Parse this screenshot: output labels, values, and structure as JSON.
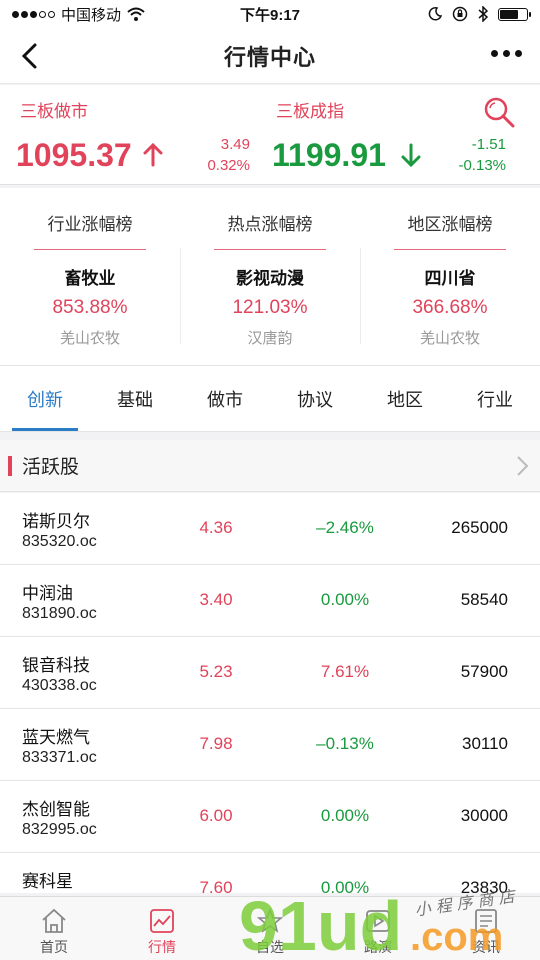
{
  "status_bar": {
    "carrier": "中国移动",
    "time": "下午9:17"
  },
  "nav": {
    "title": "行情中心"
  },
  "indices": [
    {
      "name": "三板做市",
      "value": "1095.37",
      "change": "3.49",
      "change_pct": "0.32%",
      "direction": "up"
    },
    {
      "name": "三板成指",
      "value": "1199.91",
      "change": "-1.51",
      "change_pct": "-0.13%",
      "direction": "down"
    }
  ],
  "rankings": [
    {
      "title": "行业涨幅榜",
      "sector": "畜牧业",
      "pct": "853.88%",
      "stock": "羌山农牧"
    },
    {
      "title": "热点涨幅榜",
      "sector": "影视动漫",
      "pct": "121.03%",
      "stock": "汉唐韵"
    },
    {
      "title": "地区涨幅榜",
      "sector": "四川省",
      "pct": "366.68%",
      "stock": "羌山农牧"
    }
  ],
  "tabs": [
    "创新",
    "基础",
    "做市",
    "协议",
    "地区",
    "行业"
  ],
  "section": {
    "title": "活跃股"
  },
  "stocks": [
    {
      "name": "诺斯贝尔",
      "code": "835320.oc",
      "price": "4.36",
      "change": "–2.46%",
      "volume": "265000",
      "trend": "down"
    },
    {
      "name": "中润油",
      "code": "831890.oc",
      "price": "3.40",
      "change": "0.00%",
      "volume": "58540",
      "trend": "flat"
    },
    {
      "name": "银音科技",
      "code": "430338.oc",
      "price": "5.23",
      "change": "7.61%",
      "volume": "57900",
      "trend": "up"
    },
    {
      "name": "蓝天燃气",
      "code": "833371.oc",
      "price": "7.98",
      "change": "–0.13%",
      "volume": "30110",
      "trend": "down"
    },
    {
      "name": "杰创智能",
      "code": "832995.oc",
      "price": "6.00",
      "change": "0.00%",
      "volume": "30000",
      "trend": "flat"
    },
    {
      "name": "赛科星",
      "code": "",
      "price": "7.60",
      "change": "0.00%",
      "volume": "23830",
      "trend": "flat"
    }
  ],
  "bottom_nav": [
    {
      "label": "首页",
      "icon": "home-icon"
    },
    {
      "label": "行情",
      "icon": "chart-icon",
      "active": true
    },
    {
      "label": "自选",
      "icon": "star-icon"
    },
    {
      "label": "路演",
      "icon": "play-icon"
    },
    {
      "label": "资讯",
      "icon": "news-icon"
    }
  ],
  "watermark": {
    "text": "小程序商店",
    "logo": "91ud.com"
  },
  "colors": {
    "up": "#e0435a",
    "down": "#1a9a3e",
    "accent": "#2a7cc7"
  }
}
